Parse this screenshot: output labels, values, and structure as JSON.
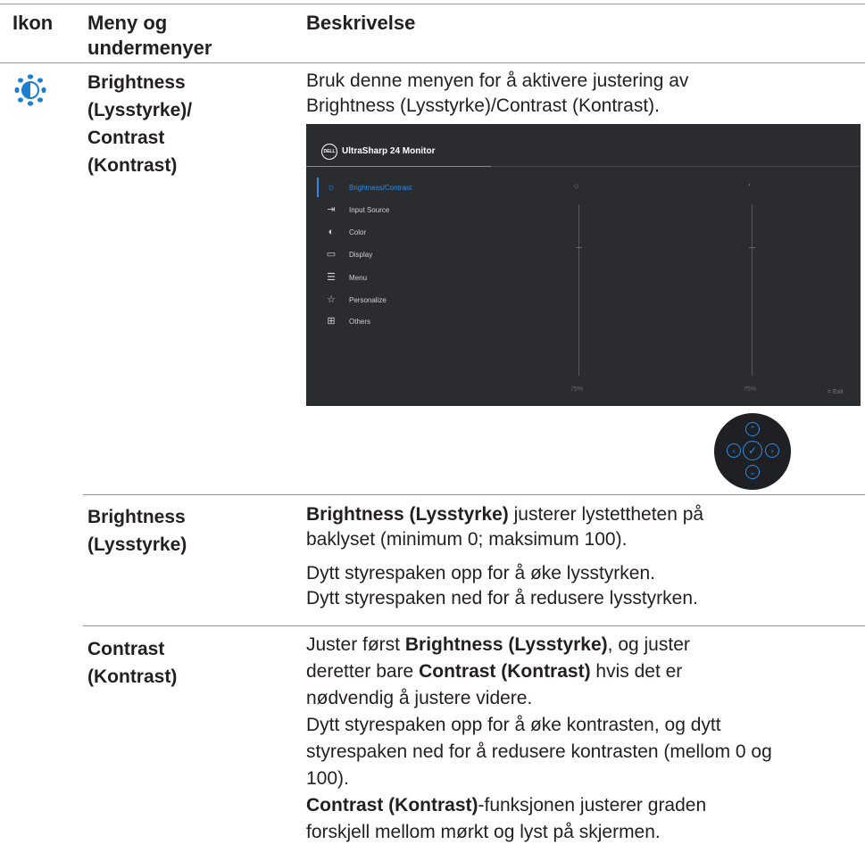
{
  "header": {
    "col1": "Ikon",
    "col2_line1": "Meny og",
    "col2_line2": "undermenyer",
    "col3": "Beskrivelse"
  },
  "row1": {
    "icon_name": "brightness-contrast-icon",
    "menu_lines": [
      "Brightness",
      "(Lysstyrke)/",
      "Contrast",
      "(Kontrast)"
    ],
    "desc_lines": [
      "Bruk denne menyen for å aktivere justering av",
      "Brightness (Lysstyrke)/Contrast (Kontrast)."
    ]
  },
  "osd": {
    "logo": "DELL",
    "title": "UltraSharp 24 Monitor",
    "menu_items": [
      {
        "icon": "sun-icon",
        "label": "Brightness/Contrast",
        "active": true
      },
      {
        "icon": "input-source-icon",
        "label": "Input Source",
        "active": false
      },
      {
        "icon": "color-palette-icon",
        "label": "Color",
        "active": false
      },
      {
        "icon": "display-monitor-icon",
        "label": "Display",
        "active": false
      },
      {
        "icon": "menu-list-icon",
        "label": "Menu",
        "active": false
      },
      {
        "icon": "star-icon",
        "label": "Personalize",
        "active": false
      },
      {
        "icon": "others-sliders-icon",
        "label": "Others",
        "active": false
      }
    ],
    "brightness_value": "75%",
    "contrast_value": "75%",
    "exit_label": "<  Exit",
    "brightness_level": 0.75,
    "contrast_level": 0.75,
    "accent_color": "#2d8de6"
  },
  "row2": {
    "menu_lines": [
      "Brightness",
      "(Lysstyrke)"
    ],
    "desc_p1_bold": "Brightness (Lysstyrke)",
    "desc_p1_rest": " justerer lystettheten på",
    "desc_p1_line2": "baklyset (minimum 0; maksimum 100).",
    "desc_p2_line1": "Dytt styrespaken opp for å øke lysstyrken.",
    "desc_p2_line2": "Dytt styrespaken ned for å redusere lysstyrken."
  },
  "row3": {
    "menu_lines": [
      "Contrast",
      "(Kontrast)"
    ],
    "l1_pre": "Juster først ",
    "l1_bold": "Brightness (Lysstyrke)",
    "l1_post": ", og juster",
    "l2_pre": "deretter bare ",
    "l2_bold": "Contrast (Kontrast)",
    "l2_post": " hvis det er",
    "l3": "nødvendig å justere videre.",
    "l4": "Dytt styrespaken opp for å øke kontrasten, og dytt",
    "l5": "styrespaken ned for å redusere kontrasten (mellom 0 og",
    "l6": "100).",
    "l7_bold": "Contrast (Kontrast)",
    "l7_post": "-funksjonen justerer graden",
    "l8": "forskjell mellom mørkt og lyst på skjermen."
  }
}
